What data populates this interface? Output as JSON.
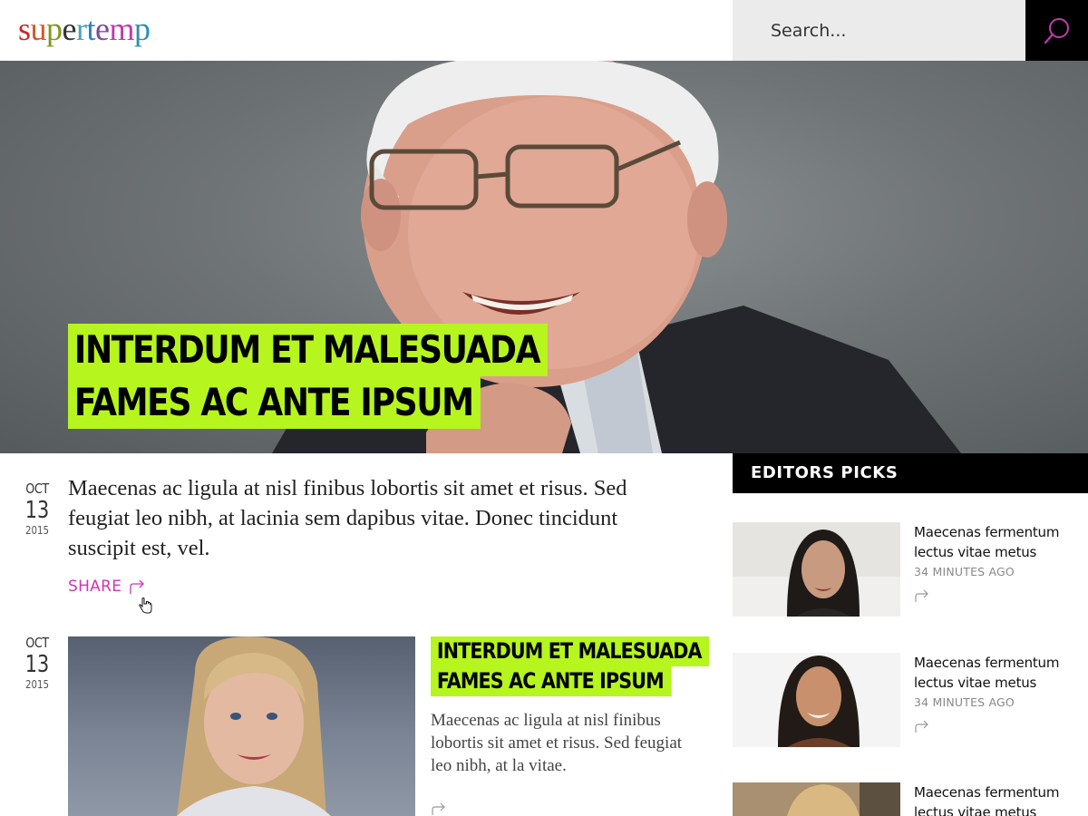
{
  "header": {
    "logo_letters": [
      "s",
      "u",
      "p",
      "e",
      "r",
      "t",
      "e",
      "m",
      "p"
    ],
    "logo_colors": [
      "#c62a2a",
      "#d6562b",
      "#7a9a1c",
      "#333333",
      "#4aa0c8",
      "#2f7fbf",
      "#7d4aa0",
      "#c23aa8",
      "#2b8fb8"
    ],
    "search_placeholder": "Search..."
  },
  "hero": {
    "title_lines": [
      "INTERDUM ET MALESUADA",
      "FAMES AC ANTE IPSUM"
    ]
  },
  "article1": {
    "date": {
      "month": "OCT",
      "day": "13",
      "year": "2015"
    },
    "excerpt": "Maecenas ac ligula at nisl finibus lobortis sit amet et risus. Sed feugiat leo nibh, at lacinia sem dapibus vitae. Donec tincidunt suscipit est, vel.",
    "share_label": "SHARE"
  },
  "article2": {
    "date": {
      "month": "OCT",
      "day": "13",
      "year": "2015"
    },
    "title_lines": [
      "INTERDUM ET MALESUADA",
      "FAMES AC ANTE IPSUM"
    ],
    "excerpt": "Maecenas ac ligula at nisl finibus lobortis sit amet et risus. Sed feugiat leo nibh, at la vitae."
  },
  "editors_picks": {
    "heading": "EDITORS PICKS",
    "items": [
      {
        "title": "Maecenas fermentum lectus vitae metus",
        "time": "34 MINUTES AGO"
      },
      {
        "title": "Maecenas fermentum lectus vitae metus",
        "time": "34 MINUTES AGO"
      },
      {
        "title": "Maecenas fermentum lectus vitae metus",
        "time": ""
      }
    ]
  },
  "colors": {
    "accent_green": "#b6f51d",
    "share_magenta": "#d234b4",
    "dark": "#000000"
  },
  "icons": [
    "search-icon",
    "share-arrow-icon",
    "hand-cursor-icon"
  ]
}
